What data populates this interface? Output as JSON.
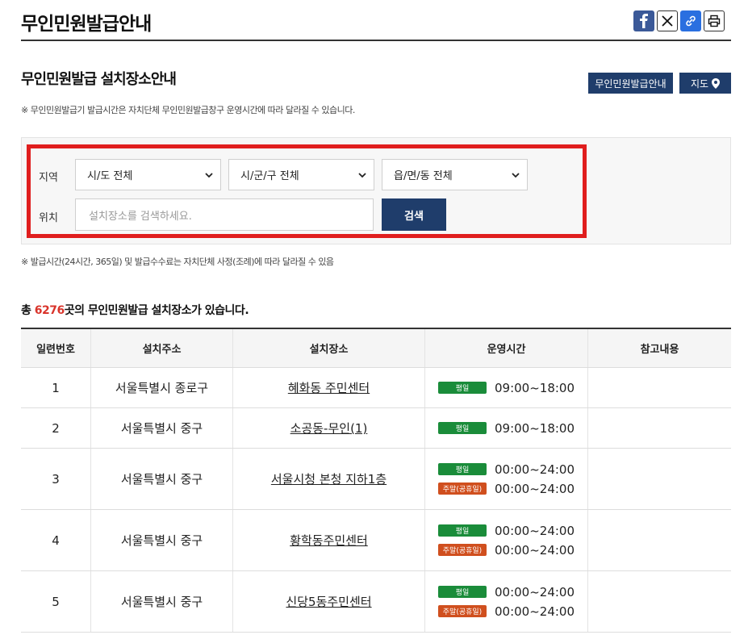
{
  "page": {
    "title": "무인민원발급안내"
  },
  "share": {
    "icons": [
      "facebook-icon",
      "x-twitter-icon",
      "link-icon",
      "print-icon"
    ]
  },
  "section": {
    "title": "무인민원발급 설치장소안내",
    "btn_guide": "무인민원발급안내",
    "btn_map": "지도",
    "note": "※ 무인민원발급기 발급시간은 자치단체 무인민원발급창구 운영시간에 따라 달라질 수 있습니다."
  },
  "search": {
    "region_label": "지역",
    "location_label": "위치",
    "sido": "시/도 전체",
    "sigungu": "시/군/구 전체",
    "eupmyeondong": "읍/면/동 전체",
    "placeholder": "설치장소를 검색하세요.",
    "button": "검색"
  },
  "note2": "※ 발급시간(24시간, 365일) 및 발급수수료는 자치단체 사정(조례)에 따라 달라질 수 있음",
  "summary": {
    "prefix": "총 ",
    "count": "6276",
    "suffix": "곳의 무인민원발급 설치장소가 있습니다."
  },
  "table": {
    "headers": [
      "일련번호",
      "설치주소",
      "설치장소",
      "운영시간",
      "참고내용"
    ],
    "rows": [
      {
        "no": "1",
        "addr": "서울특별시 종로구",
        "place": "혜화동 주민센터",
        "hours": [
          {
            "badge": "평일",
            "time": "09:00~18:00"
          }
        ]
      },
      {
        "no": "2",
        "addr": "서울특별시 중구",
        "place": "소공동-무인(1)",
        "hours": [
          {
            "badge": "평일",
            "time": "09:00~18:00"
          }
        ]
      },
      {
        "no": "3",
        "addr": "서울특별시 중구",
        "place": "서울시청 본청 지하1층",
        "hours": [
          {
            "badge": "평일",
            "time": "00:00~24:00"
          },
          {
            "badge": "주말(공휴일)",
            "time": "00:00~24:00"
          }
        ]
      },
      {
        "no": "4",
        "addr": "서울특별시 중구",
        "place": "황학동주민센터",
        "hours": [
          {
            "badge": "평일",
            "time": "00:00~24:00"
          },
          {
            "badge": "주말(공휴일)",
            "time": "00:00~24:00"
          }
        ]
      },
      {
        "no": "5",
        "addr": "서울특별시 중구",
        "place": "신당5동주민센터",
        "hours": [
          {
            "badge": "평일",
            "time": "00:00~24:00"
          },
          {
            "badge": "주말(공휴일)",
            "time": "00:00~24:00"
          }
        ]
      }
    ]
  },
  "colors": {
    "navy": "#1f3d6b",
    "highlight": "#e01e1e",
    "weekday": "#1a8c3a",
    "weekend": "#d04f1e",
    "count": "#d9342b"
  }
}
